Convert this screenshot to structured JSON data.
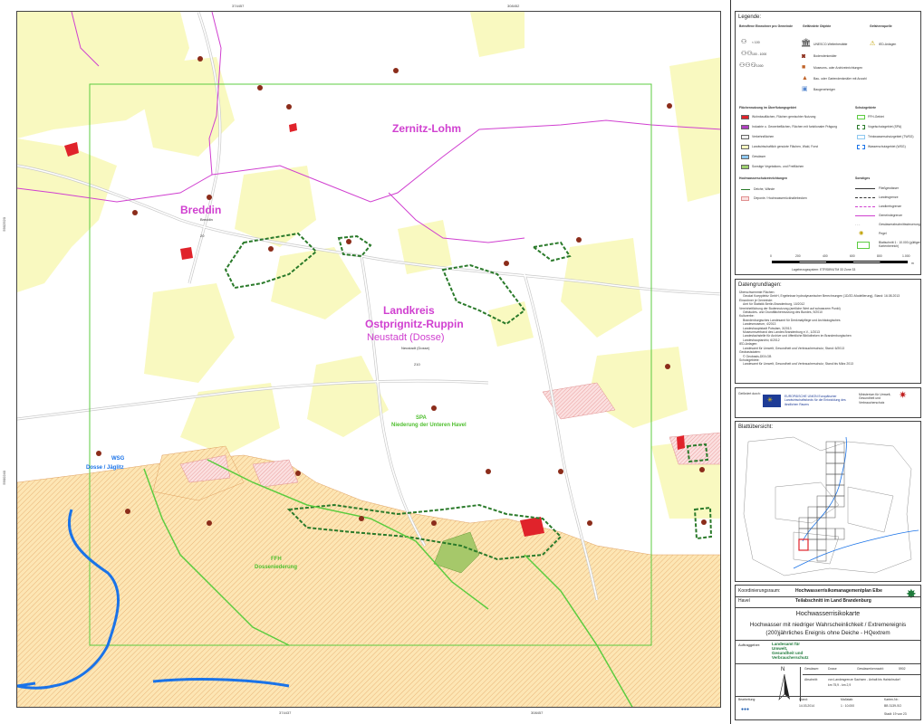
{
  "map": {
    "coords_top": [
      "374457",
      "308452"
    ],
    "coords_bottom": [
      "374437",
      "308457"
    ],
    "coords_left": [
      "5902520",
      "5900240"
    ],
    "labels": {
      "zernitz": "Zernitz-Lohm",
      "breddin": "Breddin",
      "breddin_small": "Breddin",
      "breddin_pop": "20",
      "landkreis1": "Landkreis",
      "landkreis2": "Ostprignitz-Ruppin",
      "neustadt": "Neustadt (Dosse)",
      "neustadt_small": "Neustadt (Dosse)",
      "neustadt_pop": "210",
      "spa1": "SPA",
      "spa2": "Niederung der Unteren Havel",
      "wsg1": "WSG",
      "wsg2": "Dosse / Jäglitz",
      "ffh1": "FFH",
      "ffh2": "Dosseniederung"
    },
    "colors": {
      "settlement": "#f2f2f2",
      "forest": "#ffffff",
      "agriculture": "#fbfbc8",
      "green": "#f7f9c4",
      "flood_orange": "#fde1a8",
      "flood_hatch": "#e8b878",
      "river": "#1a73e8",
      "admin_pink": "#d040d0",
      "ffh_green": "#2a8a2a",
      "spa_lightgreen": "#5ccc40",
      "road": "#ffffff",
      "road_outline": "#c8c8c8",
      "red_industry": "#e0232b"
    }
  },
  "legend": {
    "title": "Legende:",
    "col1_head": "Betroffene Einwohner pro Gemeinde",
    "col2_head": "Gefährdete Objekte",
    "col3_head": "Gefahrenquelle",
    "pop": [
      "< 100",
      "100 - 1000",
      "> 1000"
    ],
    "objects": [
      "UNESCO-Welterbestätte",
      "Bodendenkmäler",
      "Museums- oder Archiveinrichtungen",
      "Bau- oder Gartendenkmäler mit Anzahl",
      "Baugenehmiger"
    ],
    "source": [
      "IED-Anlagen"
    ],
    "land_title": "Flächennutzung im Überflutungsgebiet",
    "land": [
      "Wohnbauflächen, Flächen gemischter Nutzung",
      "Industrie u. Gewerbeflächen, Flächen mit funktionaler Prägung",
      "Verkehrsflächen",
      "Landwirtschaftlich genutzte Flächen, Wald, Forst",
      "Gewässer",
      "Sonstige Vegetations- und Freiflächen"
    ],
    "protect_title": "Schutzgebiete",
    "protect": [
      "FFH-Gebiet",
      "Vogelschutzgebiet (SPA)",
      "Trinkwasserschutzgebiet (TWSG)",
      "Wasserschutzgebiet (WSG)"
    ],
    "hw_title": "Hochwasserschutzeinrichtungen",
    "hw": [
      "Deiche, Wände",
      "Deponie / Hochwasserrückhaltebecken"
    ],
    "other_title": "Sonstiges",
    "other": [
      "Fließgewässer",
      "Landesgrenze",
      "Landkreisgrenze",
      "Gemeindegrenze",
      "Gewässerabschnittssteuerung",
      "Pegel",
      "Blattschnitt 1 : 10.000 (gültiger Kartenbereich)"
    ],
    "scale_ticks": [
      "0",
      "200",
      "400",
      "600",
      "800",
      "1.000"
    ],
    "scale_unit": "m",
    "projection": "Lagebezugssystem: ETRS89/UTM 33 Zone 33"
  },
  "sources": {
    "title": "Datengrundlagen:",
    "lines": [
      "Überschwemmte Flächen:",
      "Geodat Koepplebiz GmbH, Ergebnisse hydrodynamischer Berechnungen (1D/2D-Modellierung), Stand: 16.08.2013",
      "Einwohner je Gemeinde:",
      "Amt für Statistik Berlin-Brandenburg, 10/2012",
      "Vereinheitlichung der Bodennutzung (amtliche Wert auf schwarzem Punkt)",
      "Gebäudes- und Grundflächennutzung des Bundes, 9/2010",
      "Kulturerbe:",
      "Brandenburgisches Landesamt für Denkmalpflege und Archäologisches",
      "Landesmuseum, 4/2013",
      "Landeshauptstadt Potsdam, 3/2013",
      "Museumsverband des Landes Brandenburg e.V., 1/2013",
      "Landesfachstelle für Archive und öffentliche Bibliotheken im Brandenburgischen",
      "Landeshauptarchiv, 6/2012",
      "IED-Anlagen:",
      "Landesamt für Umwelt, Gesundheit und Verbraucherschutz, Stand: 6/2013",
      "Geobasisdaten:",
      "© Geobasis-DE/LGB",
      "Schutzgebiete:",
      "Landesamt für Umwelt, Gesundheit und Verbraucherschutz, Stand bis März 2013"
    ]
  },
  "funding": {
    "label": "Gefördert durch:",
    "eu": "EUROPÄISCHE UNION Europäischer Landwirtschaftsfonds für die Entwicklung des ländlichen Raums",
    "ministry": "Ministerium für Umwelt, Gesundheit und Verbraucherschutz"
  },
  "overview": {
    "title": "Blattübersicht:"
  },
  "titleblock": {
    "coord_label": "Koordinierungsraum:",
    "coord_value": "Hochwasserrisikomanagementplan Elbe",
    "region_label": "Havel",
    "region_value": "Teilabschnitt im Land Brandenburg",
    "main_title": "Hochwasserrisikokarte",
    "sub1": "Hochwasser mit niedriger Wahrscheinlichkeit / Extremereignis",
    "sub2": "(200)jährliches Ereignis ohne Deiche - HQextrem",
    "client_label": "Auftraggeber:",
    "client_lines": [
      "Landesamt für",
      "Umwelt,",
      "Gesundheit und",
      "Verbraucherschutz"
    ],
    "north": "N",
    "water_label": "Gewässer:",
    "water_value": "Dosse",
    "code_label": "Gewässerkennzahl:",
    "code_value": "5902",
    "section_label": "Abschnitt:",
    "section_value": "von Landesgrenze Sachsen - Anhalt bis Hainichsdorf",
    "km": "km 75,9 - km 2,9",
    "edit_label": "Bearbeitung:",
    "status_label": "Stand:",
    "status_value": "14.03.2014",
    "scale_label": "Maßstab:",
    "scale_value": "1 : 10.000",
    "sheet_label": "Karten-Nr.:",
    "sheet_value": "BB 3139-SO",
    "sheet_count": "Stadt: 19 von 23"
  }
}
